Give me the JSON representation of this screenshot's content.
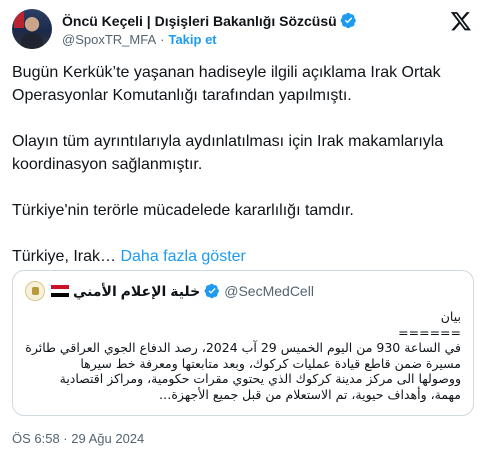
{
  "author": {
    "display_name": "Öncü Keçeli | Dışişleri Bakanlığı Sözcüsü",
    "handle": "@SpoxTR_MFA",
    "separator": "·",
    "follow_label": "Takip et"
  },
  "tweet": {
    "paragraph_1": "Bugün Kerkük’te yaşanan hadiseyle ilgili açıklama Irak Ortak Operasyonlar Komutanlığı tarafından yapılmıştı.",
    "paragraph_2": "Olayın tüm ayrıntılarıyla aydınlatılması için Irak makamlarıyla koordinasyon sağlanmıştır.",
    "paragraph_3": "Türkiye'nin terörle mücadelede kararlılığı tamdır.",
    "paragraph_4_text": "Türkiye, Irak… ",
    "show_more_label": "Daha fazla göster"
  },
  "quoted_tweet": {
    "display_name": "خلية الإعلام الأمني",
    "handle": "@SecMedCell",
    "line_1": "بيان",
    "line_2": "======",
    "line_3": "في الساعة 930 من اليوم الخميس 29 آب 2024، رصد الدفاع الجوي العراقي طائرة",
    "line_4": "مسيرة ضمن قاطع قيادة عمليات كركوك، وبعد متابعتها ومعرفة خط سيرها",
    "line_5": "ووصولها الى مركز مدينة كركوك الذي يحتوي مقرات حكومية، ومراكز اقتصادية",
    "line_6": "مهمة، وأهداف حيوية، تم الاستعلام من قبل جميع الأجهزة…"
  },
  "timestamp": "ÖS 6:58 · 29 Ağu 2024",
  "icons": {
    "verified": "verified-badge-icon",
    "x_logo": "x-logo-icon",
    "flag": "iraq-flag-icon"
  },
  "colors": {
    "accent": "#1d9bf0",
    "muted": "#536471",
    "text": "#0f1419",
    "border": "#cfd9de"
  }
}
